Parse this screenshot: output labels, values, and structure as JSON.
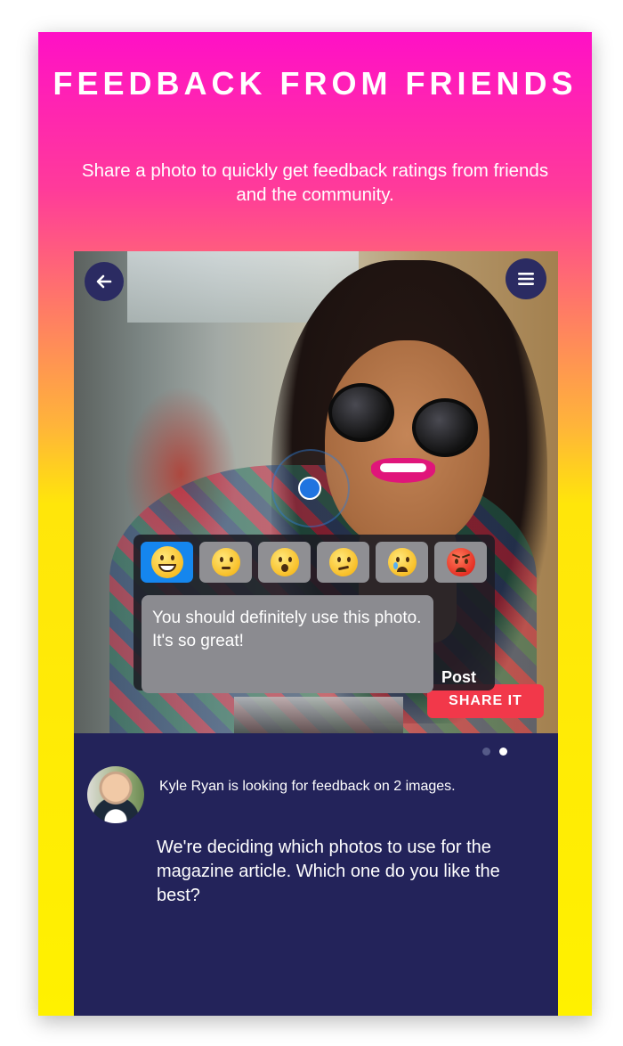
{
  "header": {
    "title": "FEEDBACK FROM FRIENDS",
    "subtitle": "Share a photo to quickly get feedback ratings from friends and the community."
  },
  "photo_view": {
    "back_icon": "arrow-left-icon",
    "menu_icon": "hamburger-menu-icon",
    "share_button_label": "SHARE IT"
  },
  "feedback": {
    "emojis": [
      {
        "name": "grinning-emoji",
        "selected": true
      },
      {
        "name": "thinking-emoji",
        "selected": false
      },
      {
        "name": "surprised-emoji",
        "selected": false
      },
      {
        "name": "confused-emoji",
        "selected": false
      },
      {
        "name": "crying-emoji",
        "selected": false
      },
      {
        "name": "angry-emoji",
        "selected": false
      }
    ],
    "comment_text": "You should definitely use this photo. It's so great!",
    "post_label": "Post"
  },
  "pager": {
    "total": 2,
    "active_index": 1
  },
  "request": {
    "author_line": "Kyle Ryan is looking for feedback on 2 images.",
    "message": "We're deciding which photos to use for the magazine article. Which one do you like the best?"
  },
  "colors": {
    "gradient_top": "#ff10c6",
    "gradient_bottom": "#fff100",
    "panel_bg": "#23235a",
    "accent_blue": "#1586ee",
    "share_red": "#f2384a"
  }
}
